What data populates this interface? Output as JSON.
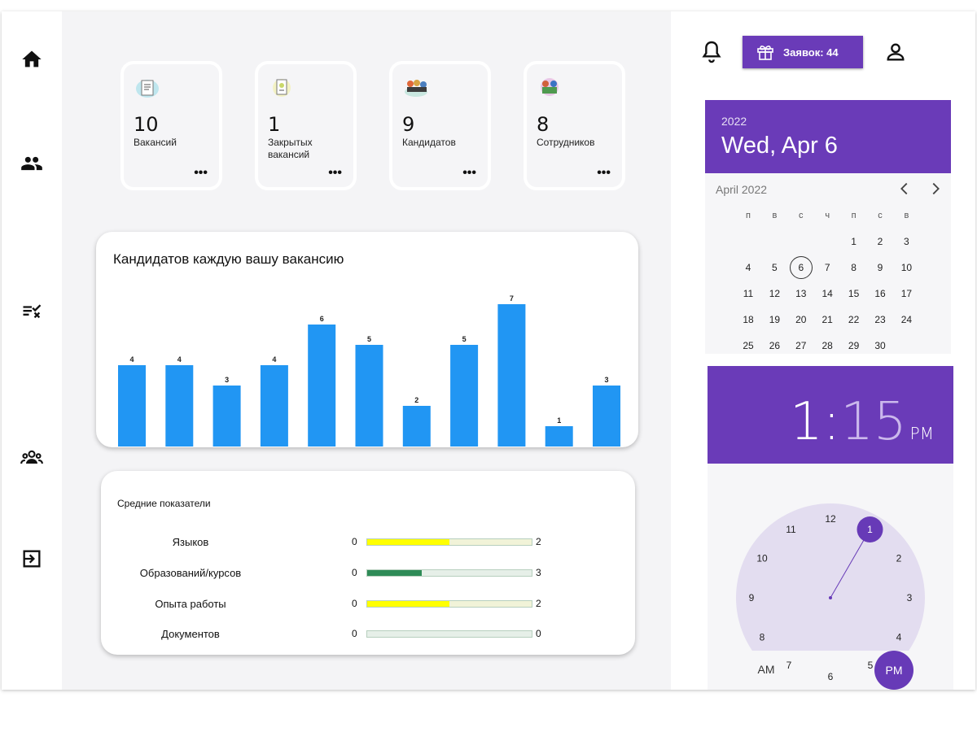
{
  "sidebar": {
    "items": [
      {
        "name": "home",
        "icon": "home-icon"
      },
      {
        "name": "candidates",
        "icon": "people-icon"
      },
      {
        "name": "tasks",
        "icon": "checklist-icon"
      },
      {
        "name": "employees",
        "icon": "group-icon"
      },
      {
        "name": "logout",
        "icon": "logout-icon"
      }
    ]
  },
  "stats": [
    {
      "value": "10",
      "label": "Вакансий",
      "icon": "vacancies-icon"
    },
    {
      "value": "1",
      "label": "Закрытых вакансий",
      "icon": "closed-vacancies-icon"
    },
    {
      "value": "9",
      "label": "Кандидатов",
      "icon": "candidates-icon"
    },
    {
      "value": "8",
      "label": "Сотрудников",
      "icon": "employees-icon"
    }
  ],
  "more_label": "•••",
  "chart_data": {
    "type": "bar",
    "title": "Кандидатов каждую вашу вакансию",
    "categories": [
      "",
      "",
      "",
      "",
      "",
      "",
      "",
      "",
      "",
      "",
      ""
    ],
    "values": [
      4,
      4,
      3,
      4,
      6,
      5,
      2,
      5,
      7,
      1,
      3
    ],
    "ylim": [
      0,
      7
    ],
    "color": "#2196f3",
    "grid": false
  },
  "averages": {
    "title": "Средние показатели",
    "rows": [
      {
        "label": "Языков",
        "min": "0",
        "max": "2",
        "fraction": 0.5,
        "color": "#ffff00"
      },
      {
        "label": "Образований/курсов",
        "min": "0",
        "max": "3",
        "fraction": 0.33,
        "color": "#2e8b57"
      },
      {
        "label": "Опыта работы",
        "min": "0",
        "max": "2",
        "fraction": 0.5,
        "color": "#ffff00"
      },
      {
        "label": "Документов",
        "min": "0",
        "max": "0",
        "fraction": 0,
        "color": "#2e8b57"
      }
    ]
  },
  "header": {
    "requests_label": "Заявок: 44",
    "bell_icon": "bell-icon",
    "gift_icon": "gift-icon",
    "user_icon": "user-icon"
  },
  "calendar": {
    "year": "2022",
    "selected_date": "Wed, Apr 6",
    "month_label": "April 2022",
    "weekdays": [
      "п",
      "в",
      "с",
      "ч",
      "п",
      "с",
      "в"
    ],
    "first_offset": 4,
    "days": 30,
    "selected_day": 6,
    "accent": "#673ab7"
  },
  "clock": {
    "hour": "1",
    "separator": ":",
    "minute": "15",
    "period": "PM",
    "numbers": [
      "12",
      "1",
      "2",
      "3",
      "4",
      "5",
      "6",
      "7",
      "8",
      "9",
      "10",
      "11"
    ],
    "selected_hour": 1,
    "am_label": "AM",
    "pm_label": "PM"
  }
}
